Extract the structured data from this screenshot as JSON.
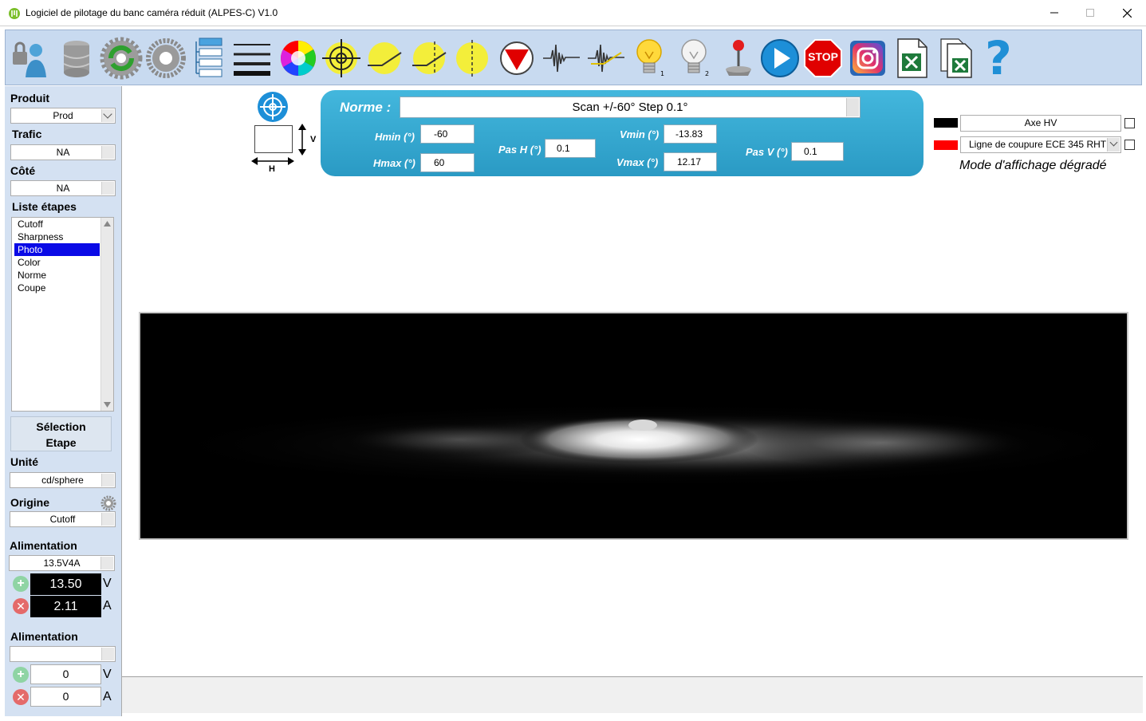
{
  "window": {
    "title": "Logiciel de pilotage du banc caméra réduit (ALPES-C)  V1.0"
  },
  "toolbar": {
    "icons": [
      "user-lock-icon",
      "database-icon",
      "settings-refresh-icon",
      "gear-icon",
      "list-icon",
      "lines-icon",
      "color-wheel-icon",
      "target-icon",
      "cutoff-line-icon",
      "cutoff-angle-icon",
      "vertical-line-icon",
      "down-arrow-icon",
      "signal-icon",
      "signal-cut-icon",
      "bulb-on-icon",
      "bulb-off-icon",
      "joystick-icon",
      "play-icon",
      "stop-icon",
      "instagram-icon",
      "excel-icon",
      "excel-multi-icon",
      "help-icon"
    ],
    "stop_label": "STOP",
    "help_label": "?"
  },
  "left": {
    "produit_label": "Produit",
    "produit_value": "Prod",
    "trafic_label": "Trafic",
    "trafic_value": "NA",
    "cote_label": "Côté",
    "cote_value": "NA",
    "liste_label": "Liste étapes",
    "steps": [
      "Cutoff",
      "Sharpness",
      "Photo",
      "Color",
      "Norme",
      "Coupe"
    ],
    "selected_step": "Photo",
    "selection_btn_line1": "Sélection",
    "selection_btn_line2": "Etape",
    "unite_label": "Unité",
    "unite_value": "cd/sphere",
    "origine_label": "Origine",
    "origine_value": "Cutoff",
    "alim1_label": "Alimentation",
    "alim1_value": "13.5V4A",
    "alim1_voltage": "13.50",
    "alim1_current": "2.11",
    "alim2_label": "Alimentation",
    "alim2_value": "",
    "alim2_voltage": "0",
    "alim2_current": "0",
    "unit_v": "V",
    "unit_a": "A"
  },
  "axes_widget": {
    "v_label": "V",
    "h_label": "H"
  },
  "norme": {
    "label": "Norme :",
    "value": "Scan +/-60° Step 0.1°",
    "hmin_label": "Hmin (°)",
    "hmin_value": "-60",
    "hmax_label": "Hmax (°)",
    "hmax_value": "60",
    "pash_label": "Pas H (°)",
    "pash_value": "0.1",
    "vmin_label": "Vmin (°)",
    "vmin_value": "-13.83",
    "vmax_label": "Vmax (°)",
    "vmax_value": "12.17",
    "pasv_label": "Pas V (°)",
    "pasv_value": "0.1"
  },
  "legend": {
    "axe_color": "#000000",
    "axe_label": "Axe HV",
    "coupure_color": "#ff0000",
    "coupure_label": "Ligne de coupure ECE 345 RHT",
    "mode_label": "Mode d'affichage dégradé"
  }
}
